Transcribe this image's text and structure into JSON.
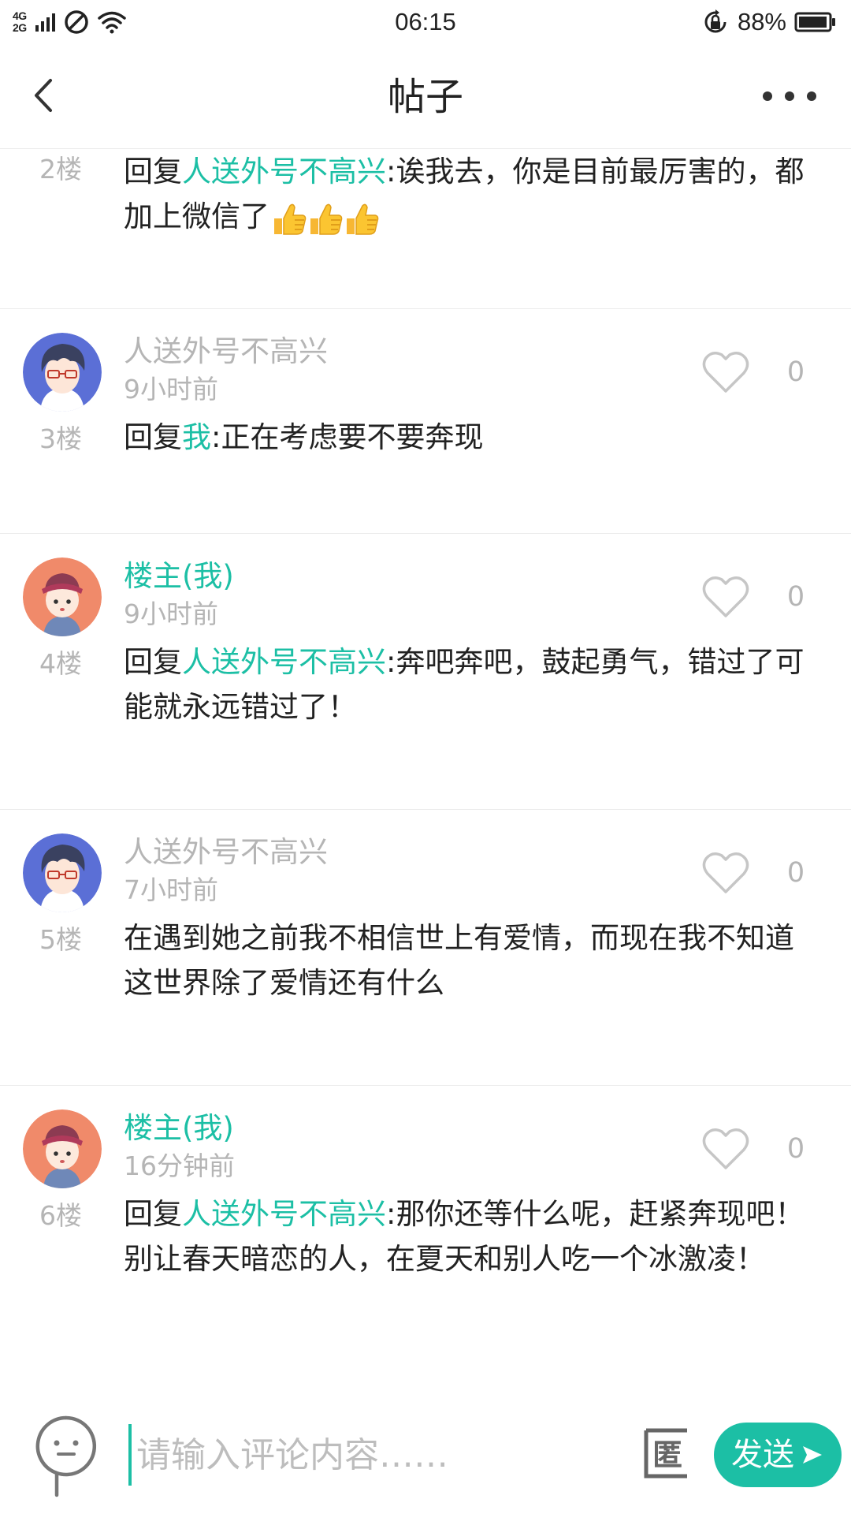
{
  "status_bar": {
    "network_top": "4G",
    "network_bottom": "2G",
    "time": "06:15",
    "battery": "88%"
  },
  "header": {
    "title": "帖子"
  },
  "comments": [
    {
      "floor": "2楼",
      "reply_prefix": "回复",
      "reply_target": "人送外号不高兴",
      "text": ":诶我去，你是目前最厉害的，都加上微信了",
      "emoji": "thumbs-up x3"
    },
    {
      "username": "人送外号不高兴",
      "time": "9小时前",
      "likes": "0",
      "floor": "3楼",
      "reply_prefix": "回复",
      "reply_target": "我",
      "text": ":正在考虑要不要奔现"
    },
    {
      "username": "楼主(我)",
      "time": "9小时前",
      "likes": "0",
      "floor": "4楼",
      "reply_prefix": "回复",
      "reply_target": "人送外号不高兴",
      "text": ":奔吧奔吧，鼓起勇气，错过了可能就永远错过了！"
    },
    {
      "username": "人送外号不高兴",
      "time": "7小时前",
      "likes": "0",
      "floor": "5楼",
      "text": "在遇到她之前我不相信世上有爱情，而现在我不知道这世界除了爱情还有什么"
    },
    {
      "username": "楼主(我)",
      "time": "16分钟前",
      "likes": "0",
      "floor": "6楼",
      "reply_prefix": "回复",
      "reply_target": "人送外号不高兴",
      "text": ":那你还等什么呢，赶紧奔现吧！别让春天暗恋的人，在夏天和别人吃一个冰激凌！"
    }
  ],
  "input_bar": {
    "placeholder": "请输入评论内容……",
    "anon_label": "匿",
    "send_label": "发送"
  },
  "colors": {
    "accent": "#1cbfa5",
    "muted_text": "#b5b5b5",
    "body_text": "#222222",
    "divider": "#ececec"
  }
}
